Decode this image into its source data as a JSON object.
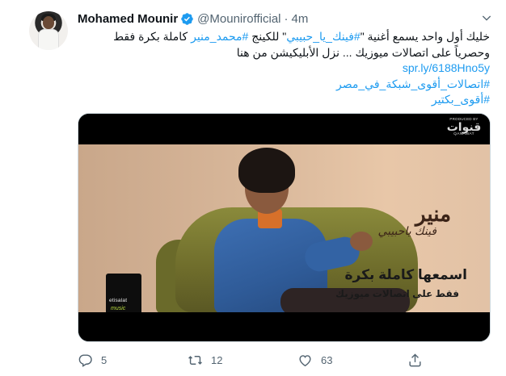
{
  "user": {
    "name": "Mohamed Mounir",
    "handle": "@Mounirofficial",
    "separator": "·",
    "time": "4m"
  },
  "tweet": {
    "line1_part1": "خليك أول واحد يسمع أغنية \"",
    "line1_hashtag1": "#فينك_يا_حبيبي",
    "line1_part2": "\" للكينج ",
    "line1_hashtag2": "#محمد_منير",
    "line1_part3": " كاملة بكرة فقط",
    "line2": "وحصرياً على اتصالات ميوزيك ... نزل الأبليكيشن من هنا",
    "link": "spr.ly/6188Hno5y",
    "hashtag3": "#اتصالات_أقوى_شبكة_في_مصر",
    "hashtag4": "#أقوى_بكتير"
  },
  "media": {
    "artist_title": "منير",
    "song_title": "فينك ياحبيبي",
    "ad_line1": "اسمعها كاملة بكرة",
    "ad_line2": "فقط على اتصالات ميوزيك",
    "brand_top": "etisalat",
    "brand_bottom": "music",
    "producer_label": "PRODUCED BY",
    "producer_mark": "قنوات",
    "producer_name": "QANAWAT"
  },
  "actions": {
    "replies": "5",
    "retweets": "12",
    "likes": "63"
  },
  "colors": {
    "link": "#1d9bf0",
    "verified": "#1d9bf0",
    "muted": "#536471"
  }
}
